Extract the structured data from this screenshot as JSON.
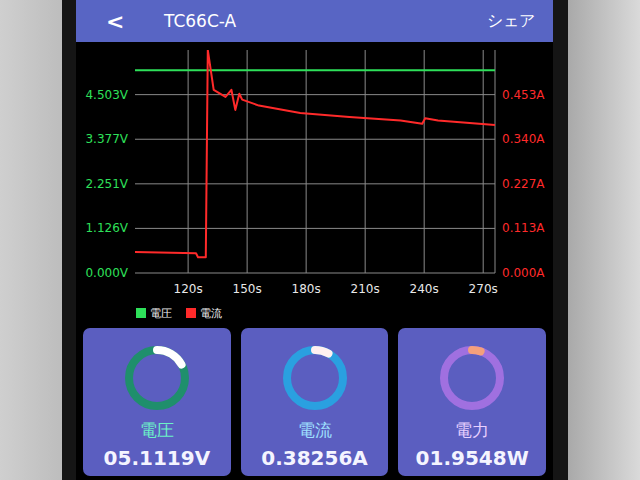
{
  "header": {
    "back": "<",
    "title": "TC66C-A",
    "share": "シェア"
  },
  "chart": {
    "left_ticks": [
      "4.503V",
      "3.377V",
      "2.251V",
      "1.126V",
      "0.000V"
    ],
    "right_ticks": [
      "0.453A",
      "0.340A",
      "0.227A",
      "0.113A",
      "0.000A"
    ],
    "x_ticks": [
      "120s",
      "150s",
      "180s",
      "210s",
      "240s",
      "270s"
    ],
    "series": [
      {
        "name": "電圧",
        "color": "#2ee05a",
        "axis": "left",
        "times": [
          93,
          276
        ],
        "values": [
          5.12,
          5.12
        ]
      },
      {
        "name": "電流",
        "color": "#ff2a2a",
        "axis": "right",
        "times": [
          93,
          124,
          125,
          129,
          130,
          133,
          139,
          142,
          144,
          146,
          147.5,
          156,
          177,
          202,
          228,
          239,
          240.5,
          247,
          276
        ],
        "values": [
          0.053,
          0.05,
          0.04,
          0.04,
          0.566,
          0.465,
          0.447,
          0.465,
          0.414,
          0.455,
          0.44,
          0.425,
          0.406,
          0.396,
          0.387,
          0.379,
          0.393,
          0.387,
          0.376
        ]
      }
    ]
  },
  "cards": [
    {
      "label": "電圧",
      "value": "05.1119V",
      "level": 0.17,
      "color": "#1f8f6c"
    },
    {
      "label": "電流",
      "value": "0.38256A",
      "level": 0.08,
      "color": "#2aa0e0"
    },
    {
      "label": "電力",
      "value": "01.9548W",
      "level": 0.05,
      "color": "#a070e0"
    }
  ]
}
